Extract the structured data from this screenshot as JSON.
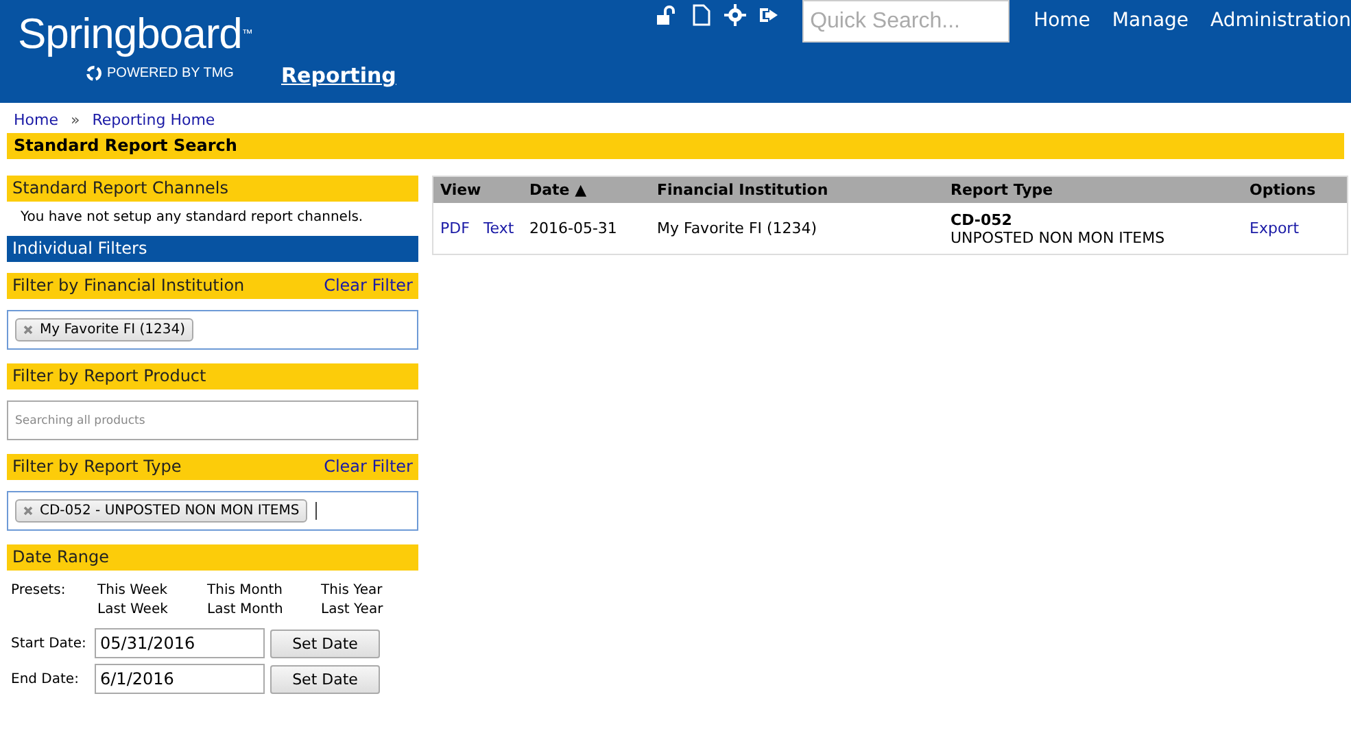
{
  "header": {
    "logo": "Springboard",
    "trademark": "™",
    "tagline": "POWERED BY TMG",
    "section_link": "Reporting",
    "search": {
      "placeholder": "Quick Search..."
    },
    "nav": [
      "Home",
      "Manage",
      "Administration"
    ]
  },
  "breadcrumb": [
    "Home",
    "»",
    "Reporting Home"
  ],
  "page_title": "Standard Report Search",
  "channels": {
    "title": "Standard Report Channels",
    "message": "You have not setup any standard report channels."
  },
  "filters_title": "Individual Filters",
  "filters": [
    {
      "kind": "tags",
      "title": "Filter by Financial Institution",
      "clear": "Clear Filter",
      "tags": [
        "My Favorite FI (1234)"
      ],
      "focused": true
    },
    {
      "kind": "empty",
      "title": "Filter by Report Product",
      "placeholder": "Searching all products",
      "focused": false
    },
    {
      "kind": "tags",
      "title": "Filter by Report Type",
      "clear": "Clear Filter",
      "tags": [
        "CD-052 - UNPOSTED NON MON ITEMS"
      ],
      "focused": true
    }
  ],
  "date_range": {
    "title": "Date Range",
    "presets_label": "Presets:",
    "presets": [
      [
        "This Week",
        "This Month",
        "This Year"
      ],
      [
        "Last Week",
        "Last Month",
        "Last Year"
      ]
    ],
    "fields": [
      {
        "label": "Start Date:",
        "value": "05/31/2016",
        "button": "Set Date"
      },
      {
        "label": "End Date:",
        "value": "6/1/2016",
        "button": "Set Date"
      }
    ]
  },
  "table": {
    "columns": [
      "View",
      "Date ▲",
      "Financial Institution",
      "Report Type",
      "Options"
    ],
    "rows": [
      {
        "links": [
          "PDF",
          "Text"
        ],
        "date": "2016-05-31",
        "institution": "My Favorite FI (1234)",
        "report_code": "CD-052",
        "report_name": "UNPOSTED NON MON ITEMS",
        "option": "Export"
      }
    ]
  }
}
